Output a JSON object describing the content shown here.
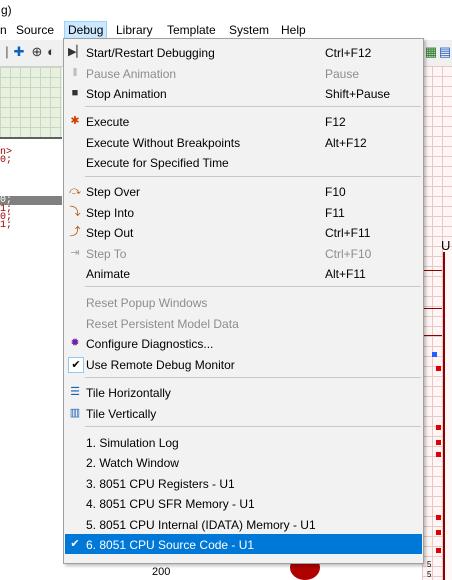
{
  "window": {
    "title_fragment": "g)"
  },
  "menubar": {
    "items": [
      {
        "label": "n"
      },
      {
        "label": "Source"
      },
      {
        "label": "Debug"
      },
      {
        "label": "Library"
      },
      {
        "label": "Template"
      },
      {
        "label": "System"
      },
      {
        "label": "Help"
      }
    ]
  },
  "editor": {
    "code_lines": [
      "n>",
      "0;",
      "0;",
      "1;",
      "0;",
      "1;"
    ]
  },
  "schematic": {
    "chip_label": "U",
    "pin_labels": [
      "5",
      "5"
    ],
    "resistor_value": "200",
    "colors": {
      "wire": "#8b0000",
      "pin_square": "#e00000",
      "accent_square": "#2060ff"
    }
  },
  "debug_menu": {
    "items": [
      {
        "label": "Start/Restart Debugging",
        "shortcut": "Ctrl+F12",
        "icon": "start-debug-icon",
        "enabled": true
      },
      {
        "label": "Pause Animation",
        "shortcut": "Pause",
        "icon": "pause-icon",
        "enabled": false
      },
      {
        "label": "Stop Animation",
        "shortcut": "Shift+Pause",
        "icon": "stop-icon",
        "enabled": true
      },
      {
        "label": "Execute",
        "shortcut": "F12",
        "icon": "execute-icon",
        "enabled": true
      },
      {
        "label": "Execute Without Breakpoints",
        "shortcut": "Alt+F12",
        "icon": "",
        "enabled": true
      },
      {
        "label": "Execute for Specified Time",
        "shortcut": "",
        "icon": "",
        "enabled": true
      },
      {
        "label": "Step Over",
        "shortcut": "F10",
        "icon": "step-over-icon",
        "enabled": true
      },
      {
        "label": "Step Into",
        "shortcut": "F11",
        "icon": "step-into-icon",
        "enabled": true
      },
      {
        "label": "Step Out",
        "shortcut": "Ctrl+F11",
        "icon": "step-out-icon",
        "enabled": true
      },
      {
        "label": "Step To",
        "shortcut": "Ctrl+F10",
        "icon": "step-to-icon",
        "enabled": false
      },
      {
        "label": "Animate",
        "shortcut": "Alt+F11",
        "icon": "",
        "enabled": true
      },
      {
        "label": "Reset Popup Windows",
        "shortcut": "",
        "icon": "",
        "enabled": false
      },
      {
        "label": "Reset Persistent Model Data",
        "shortcut": "",
        "icon": "",
        "enabled": false
      },
      {
        "label": "Configure Diagnostics...",
        "shortcut": "",
        "icon": "bug-icon",
        "enabled": true
      },
      {
        "label": "Use Remote Debug Monitor",
        "shortcut": "",
        "icon": "checkmark-icon",
        "enabled": true,
        "checked": true
      },
      {
        "label": "Tile Horizontally",
        "shortcut": "",
        "icon": "tile-horizontal-icon",
        "enabled": true
      },
      {
        "label": "Tile Vertically",
        "shortcut": "",
        "icon": "tile-vertical-icon",
        "enabled": true
      },
      {
        "label": "1. Simulation Log",
        "shortcut": "",
        "icon": "",
        "enabled": true
      },
      {
        "label": "2. Watch Window",
        "shortcut": "",
        "icon": "",
        "enabled": true
      },
      {
        "label": "3. 8051 CPU Registers - U1",
        "shortcut": "",
        "icon": "",
        "enabled": true
      },
      {
        "label": "4. 8051 CPU SFR Memory - U1",
        "shortcut": "",
        "icon": "",
        "enabled": true
      },
      {
        "label": "5. 8051 CPU Internal (IDATA) Memory - U1",
        "shortcut": "",
        "icon": "",
        "enabled": true
      },
      {
        "label": "6. 8051 CPU Source Code - U1",
        "shortcut": "",
        "icon": "checkmark-icon",
        "enabled": true,
        "checked": true,
        "selected": true
      }
    ]
  }
}
